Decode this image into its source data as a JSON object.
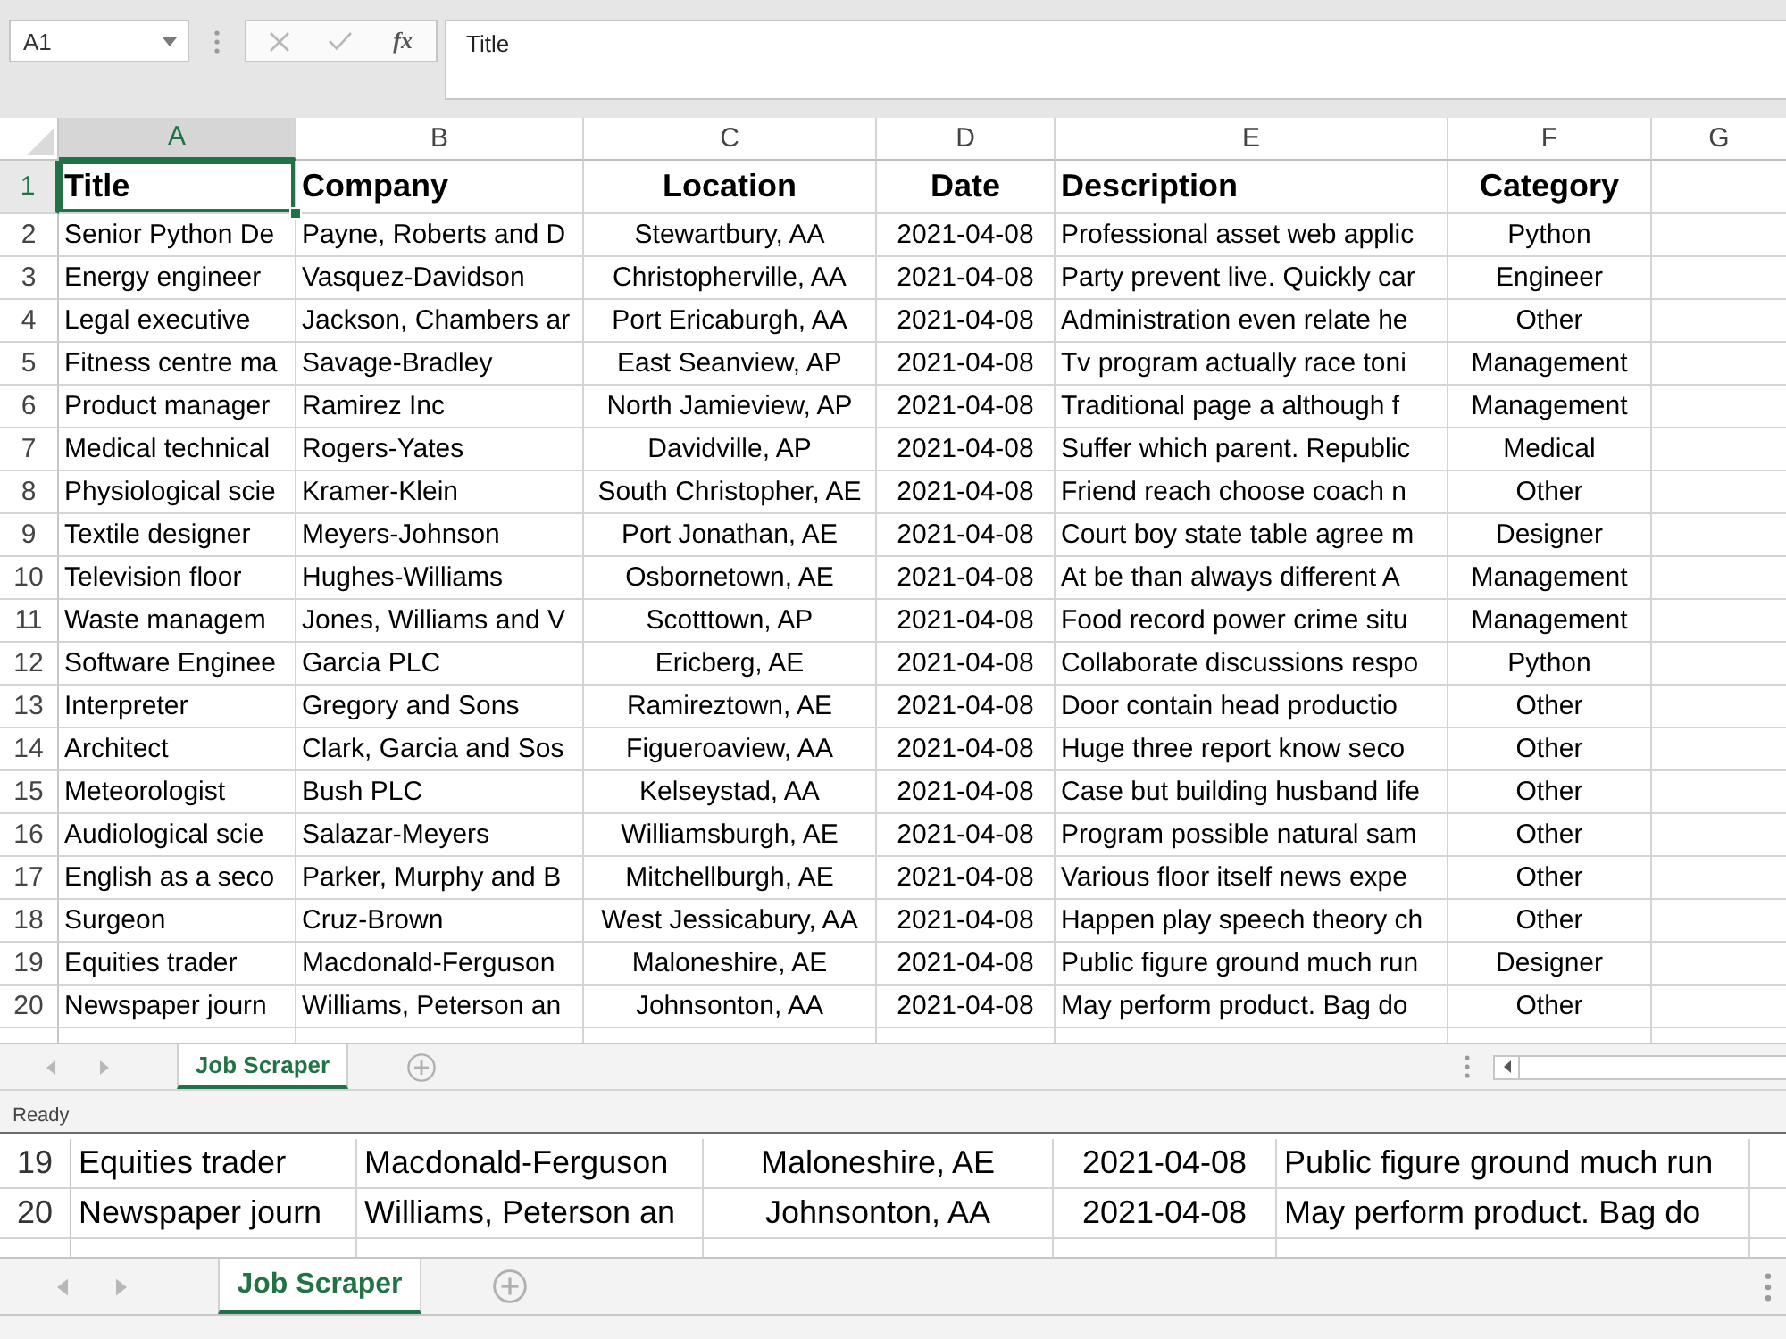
{
  "formula_bar": {
    "name_box": "A1",
    "buttons": [
      {
        "kind": "cancel",
        "disabled": true
      },
      {
        "kind": "enter",
        "disabled": true
      },
      {
        "kind": "function",
        "label": "fx",
        "disabled": false
      }
    ],
    "formula": "Title"
  },
  "sheet": {
    "columns": [
      {
        "label": "A",
        "selected": true
      },
      {
        "label": "B",
        "selected": false
      },
      {
        "label": "C",
        "selected": false
      },
      {
        "label": "D",
        "selected": false
      },
      {
        "label": "E",
        "selected": false
      },
      {
        "label": "F",
        "selected": false
      },
      {
        "label": "G",
        "selected": false
      }
    ],
    "rows": [
      {
        "number": "1",
        "kind": "header",
        "selected": true,
        "cells": [
          "Title",
          "Company",
          "Location",
          "Date",
          "Description",
          "Category"
        ]
      },
      {
        "number": "2",
        "kind": "data",
        "selected": false,
        "cells": [
          "Senior Python De",
          "Payne, Roberts and D",
          "Stewartbury, AA",
          "2021-04-08",
          "Professional asset web applic",
          "Python"
        ]
      },
      {
        "number": "3",
        "kind": "data",
        "selected": false,
        "cells": [
          "Energy engineer",
          "Vasquez-Davidson",
          "Christopherville, AA",
          "2021-04-08",
          "Party prevent live. Quickly car",
          "Engineer"
        ]
      },
      {
        "number": "4",
        "kind": "data",
        "selected": false,
        "cells": [
          "Legal executive",
          "Jackson, Chambers ar",
          "Port Ericaburgh, AA",
          "2021-04-08",
          "Administration even relate he",
          "Other"
        ]
      },
      {
        "number": "5",
        "kind": "data",
        "selected": false,
        "cells": [
          "Fitness centre ma",
          "Savage-Bradley",
          "East Seanview, AP",
          "2021-04-08",
          "Tv program actually race toni",
          "Management"
        ]
      },
      {
        "number": "6",
        "kind": "data",
        "selected": false,
        "cells": [
          "Product manager",
          "Ramirez Inc",
          "North Jamieview, AP",
          "2021-04-08",
          "Traditional page a although f",
          "Management"
        ]
      },
      {
        "number": "7",
        "kind": "data",
        "selected": false,
        "cells": [
          "Medical technical",
          "Rogers-Yates",
          "Davidville, AP",
          "2021-04-08",
          "Suffer which parent. Republic",
          "Medical"
        ]
      },
      {
        "number": "8",
        "kind": "data",
        "selected": false,
        "cells": [
          "Physiological scie",
          "Kramer-Klein",
          "South Christopher, AE",
          "2021-04-08",
          "Friend reach choose coach n",
          "Other"
        ]
      },
      {
        "number": "9",
        "kind": "data",
        "selected": false,
        "cells": [
          "Textile designer",
          "Meyers-Johnson",
          "Port Jonathan, AE",
          "2021-04-08",
          "Court boy state table agree m",
          "Designer"
        ]
      },
      {
        "number": "10",
        "kind": "data",
        "selected": false,
        "cells": [
          "Television floor",
          "Hughes-Williams",
          "Osbornetown, AE",
          "2021-04-08",
          "At be than always different A",
          "Management"
        ]
      },
      {
        "number": "11",
        "kind": "data",
        "selected": false,
        "cells": [
          "Waste managem",
          "Jones, Williams and V",
          "Scotttown, AP",
          "2021-04-08",
          "Food record power crime situ",
          "Management"
        ]
      },
      {
        "number": "12",
        "kind": "data",
        "selected": false,
        "cells": [
          "Software Enginee",
          "Garcia PLC",
          "Ericberg, AE",
          "2021-04-08",
          "Collaborate discussions respo",
          "Python"
        ]
      },
      {
        "number": "13",
        "kind": "data",
        "selected": false,
        "cells": [
          "Interpreter",
          "Gregory and Sons",
          "Ramireztown, AE",
          "2021-04-08",
          "Door contain head productio",
          "Other"
        ]
      },
      {
        "number": "14",
        "kind": "data",
        "selected": false,
        "cells": [
          "Architect",
          "Clark, Garcia and Sos",
          "Figueroaview, AA",
          "2021-04-08",
          "Huge three report know seco",
          "Other"
        ]
      },
      {
        "number": "15",
        "kind": "data",
        "selected": false,
        "cells": [
          "Meteorologist",
          "Bush PLC",
          "Kelseystad, AA",
          "2021-04-08",
          "Case but building husband life",
          "Other"
        ]
      },
      {
        "number": "16",
        "kind": "data",
        "selected": false,
        "cells": [
          "Audiological scie",
          "Salazar-Meyers",
          "Williamsburgh, AE",
          "2021-04-08",
          "Program possible natural sam",
          "Other"
        ]
      },
      {
        "number": "17",
        "kind": "data",
        "selected": false,
        "cells": [
          "English as a seco",
          "Parker, Murphy and B",
          "Mitchellburgh, AE",
          "2021-04-08",
          "Various floor itself news expe",
          "Other"
        ]
      },
      {
        "number": "18",
        "kind": "data",
        "selected": false,
        "cells": [
          "Surgeon",
          "Cruz-Brown",
          "West Jessicabury, AA",
          "2021-04-08",
          "Happen play speech theory ch",
          "Other"
        ]
      },
      {
        "number": "19",
        "kind": "data",
        "selected": false,
        "cells": [
          "Equities trader",
          "Macdonald-Ferguson",
          "Maloneshire, AE",
          "2021-04-08",
          "Public figure ground much run",
          "Designer"
        ]
      },
      {
        "number": "20",
        "kind": "data",
        "selected": false,
        "cells": [
          "Newspaper journ",
          "Williams, Peterson an",
          "Johnsonton, AA",
          "2021-04-08",
          "May perform product. Bag do",
          "Other"
        ]
      }
    ]
  },
  "sheet_tabs": [
    {
      "label": "Job Scraper",
      "selected": true
    }
  ],
  "status_bar": {
    "text": "Ready"
  },
  "magnified_view": {
    "rows": [
      {
        "number": "19",
        "cells": [
          "Equities trader",
          "Macdonald-Ferguson",
          "Maloneshire, AE",
          "2021-04-08",
          "Public figure ground much run"
        ]
      },
      {
        "number": "20",
        "cells": [
          "Newspaper journ",
          "Williams, Peterson an",
          "Johnsonton, AA",
          "2021-04-08",
          "May perform product. Bag do"
        ]
      }
    ],
    "sheet_tabs": [
      {
        "label": "Job Scraper",
        "selected": true
      }
    ]
  }
}
